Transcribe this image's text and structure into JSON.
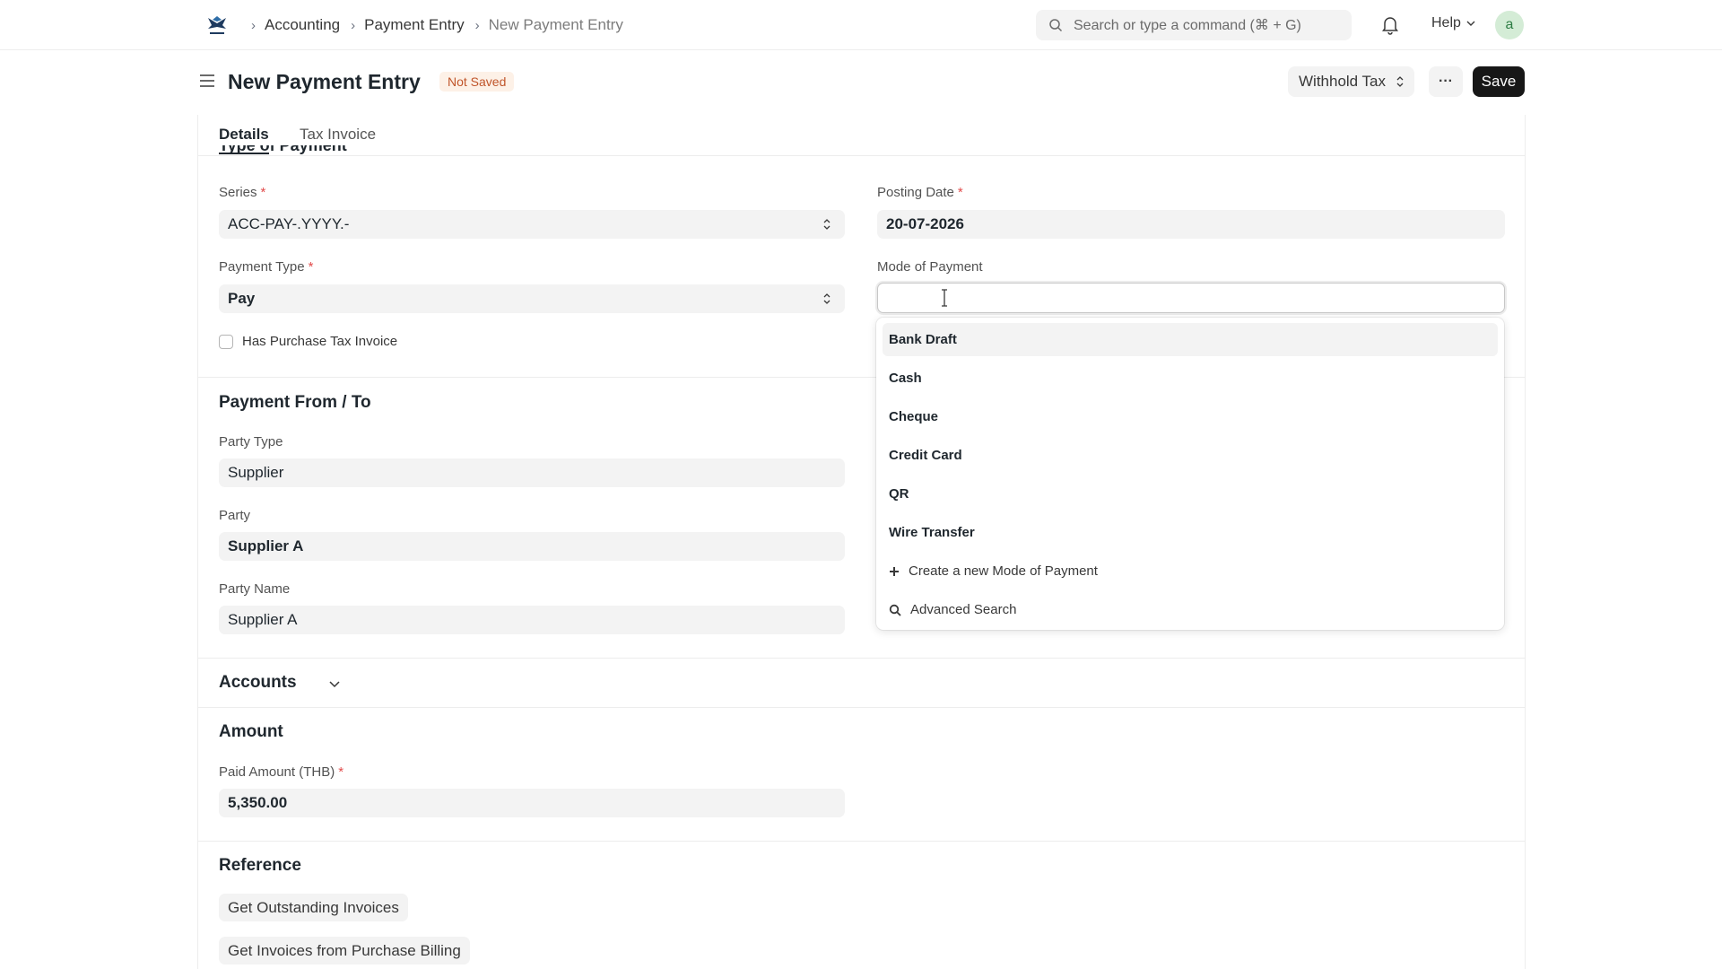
{
  "navbar": {
    "breadcrumbs": [
      "Accounting",
      "Payment Entry",
      "New Payment Entry"
    ],
    "search_placeholder": "Search or type a command (⌘ + G)",
    "help_label": "Help",
    "avatar_initial": "a"
  },
  "page": {
    "title": "New Payment Entry",
    "status": "Not Saved",
    "withhold_tax_label": "Withhold Tax",
    "more_label": "···",
    "save_label": "Save"
  },
  "tabs": [
    {
      "label": "Details",
      "active": true
    },
    {
      "label": "Tax Invoice",
      "active": false
    }
  ],
  "type_of_payment": {
    "heading": "Type of Payment",
    "series": {
      "label": "Series",
      "value": "ACC-PAY-.YYYY.-"
    },
    "posting_date": {
      "label": "Posting Date",
      "value": "20-07-2026"
    },
    "payment_type": {
      "label": "Payment Type",
      "value": "Pay"
    },
    "mode_of_payment": {
      "label": "Mode of Payment",
      "value": ""
    },
    "has_purchase_tax_invoice": {
      "label": "Has Purchase Tax Invoice",
      "checked": false
    }
  },
  "payment_from_to": {
    "heading": "Payment From / To",
    "party_type": {
      "label": "Party Type",
      "value": "Supplier"
    },
    "party": {
      "label": "Party",
      "value": "Supplier A"
    },
    "party_name": {
      "label": "Party Name",
      "value": "Supplier A"
    }
  },
  "accounts": {
    "heading": "Accounts"
  },
  "amount": {
    "heading": "Amount",
    "paid_amount": {
      "label": "Paid Amount (THB)",
      "value": "5,350.00"
    }
  },
  "reference": {
    "heading": "Reference",
    "get_outstanding_label": "Get Outstanding Invoices",
    "get_purchase_billing_label": "Get Invoices from Purchase Billing"
  },
  "mode_dropdown": {
    "options": [
      "Bank Draft",
      "Cash",
      "Cheque",
      "Credit Card",
      "QR",
      "Wire Transfer"
    ],
    "create_label": "Create a new Mode of Payment",
    "advanced_label": "Advanced Search"
  }
}
